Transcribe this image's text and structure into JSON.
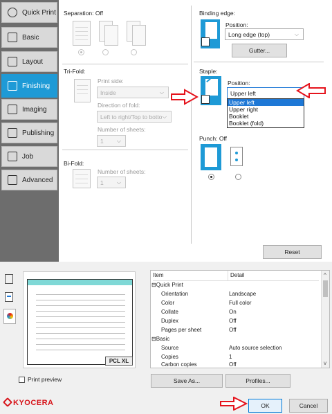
{
  "sidebar": {
    "items": [
      {
        "label": "Quick Print",
        "icon": "clock-icon"
      },
      {
        "label": "Basic",
        "icon": "document-icon"
      },
      {
        "label": "Layout",
        "icon": "layout-grid-icon"
      },
      {
        "label": "Finishing",
        "icon": "finishing-icon"
      },
      {
        "label": "Imaging",
        "icon": "image-icon"
      },
      {
        "label": "Publishing",
        "icon": "publishing-icon"
      },
      {
        "label": "Job",
        "icon": "job-icon"
      },
      {
        "label": "Advanced",
        "icon": "advanced-icon"
      }
    ],
    "active": "Finishing"
  },
  "separation": {
    "label": "Separation:",
    "value": "Off"
  },
  "trifold": {
    "label": "Tri-Fold:",
    "print_side_label": "Print side:",
    "print_side_value": "Inside",
    "direction_label": "Direction of fold:",
    "direction_value": "Left to right/Top to botto",
    "sheets_label": "Number of sheets:",
    "sheets_value": "1"
  },
  "bifold": {
    "label": "Bi-Fold:",
    "sheets_label": "Number of sheets:",
    "sheets_value": "1"
  },
  "binding": {
    "label": "Binding edge:",
    "position_label": "Position:",
    "position_value": "Long edge (top)",
    "gutter_button": "Gutter..."
  },
  "staple": {
    "label": "Staple:",
    "position_label": "Position:",
    "position_value": "Upper left",
    "options": [
      "Upper left",
      "Upper right",
      "Booklet",
      "Booklet (fold)"
    ],
    "selected_index": 0
  },
  "punch": {
    "label": "Punch:",
    "value": "Off"
  },
  "reset_button": "Reset",
  "preview": {
    "badge": "PCL XL",
    "checkbox_label": "Print preview",
    "checked": false
  },
  "summary_table": {
    "headers": [
      "Item",
      "Detail"
    ],
    "rows": [
      {
        "item": "⊟Quick Print",
        "detail": "",
        "group": true
      },
      {
        "item": "Orientation",
        "detail": "Landscape"
      },
      {
        "item": "Color",
        "detail": "Full color"
      },
      {
        "item": "Collate",
        "detail": "On"
      },
      {
        "item": "Duplex",
        "detail": "Off"
      },
      {
        "item": "Pages per sheet",
        "detail": "Off"
      },
      {
        "item": "⊟Basic",
        "detail": "",
        "group": true
      },
      {
        "item": "Source",
        "detail": "Auto source selection"
      },
      {
        "item": "Copies",
        "detail": "1"
      },
      {
        "item": "Carbon copies",
        "detail": "Off"
      }
    ]
  },
  "buttons": {
    "save_as": "Save As...",
    "profiles": "Profiles...",
    "ok": "OK",
    "cancel": "Cancel"
  },
  "brand": "KYOCERA",
  "colors": {
    "accent": "#1e9ad6",
    "annotation_arrow": "#e5131c",
    "brand": "#d7141a"
  }
}
